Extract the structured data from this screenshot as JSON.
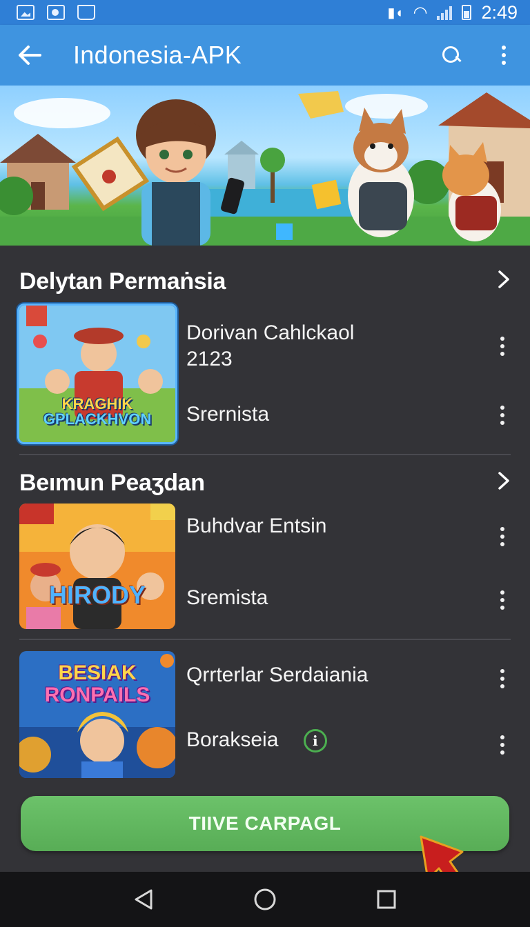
{
  "status_bar": {
    "time": "2:49"
  },
  "app_bar": {
    "title": "Indonesia-APK"
  },
  "sections": [
    {
      "title": "Delytan Permaṅsia",
      "items": [
        {
          "title_line1": "Dorivan Cahlckaol",
          "title_line2": "2123",
          "subtitle": "Srernista",
          "thumb_text": [
            "KRAGHIK",
            "GPLACKHVON"
          ],
          "thumb_icon": "game-art"
        }
      ]
    },
    {
      "title": "Beımun Peaʒdan",
      "items": [
        {
          "title_line1": "Buhdvar Entsin",
          "subtitle": "Sremista",
          "thumb_text": [
            "HIRODY"
          ],
          "thumb_icon": "game-art"
        },
        {
          "title_line1": "Qrrterlar Serdaiania",
          "subtitle": "Borakseia",
          "thumb_text": [
            "BESIAK",
            "RONPAILS"
          ],
          "thumb_icon": "game-art",
          "info_icon": "i"
        }
      ]
    }
  ],
  "cta": {
    "label": "TIIVE CARPAGL"
  },
  "colors": {
    "status_bar": "#2f7fd6",
    "app_bar": "#3f94e0",
    "background": "#333337",
    "cta": "#5fb65d",
    "nav_bar": "#141416"
  }
}
